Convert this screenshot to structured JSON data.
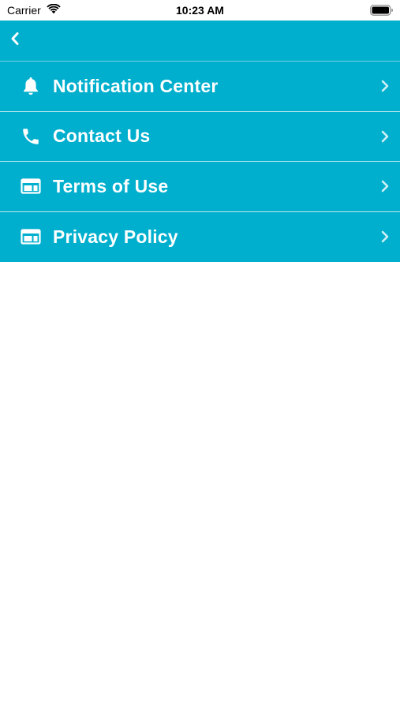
{
  "status_bar": {
    "carrier": "Carrier",
    "time": "10:23 AM",
    "wifi_icon": "wifi-icon",
    "battery_icon": "battery-full-icon"
  },
  "nav": {
    "back_icon": "chevron-left-icon"
  },
  "menu": {
    "items": [
      {
        "label": "Notification Center",
        "icon": "bell-icon"
      },
      {
        "label": "Contact Us",
        "icon": "phone-icon"
      },
      {
        "label": "Terms of Use",
        "icon": "browser-window-icon"
      },
      {
        "label": "Privacy Policy",
        "icon": "browser-window-icon"
      }
    ],
    "chevron_icon": "chevron-right-icon"
  },
  "colors": {
    "accent": "#00afce",
    "text_on_accent": "#ffffff",
    "chevron": "#cfeff5"
  }
}
